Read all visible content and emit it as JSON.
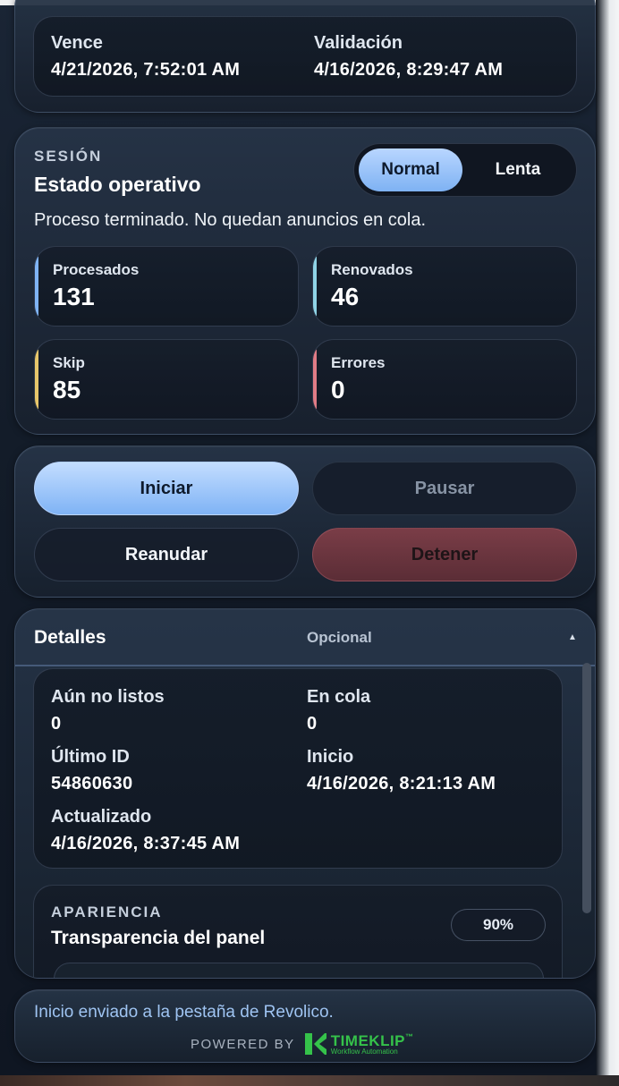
{
  "license": {
    "expires_label": "Vence",
    "expires_value": "4/21/2026, 7:52:01 AM",
    "validation_label": "Validación",
    "validation_value": "4/16/2026, 8:29:47 AM"
  },
  "session": {
    "eyebrow": "SESIÓN",
    "title": "Estado operativo",
    "mode_normal": "Normal",
    "mode_slow": "Lenta",
    "status_text": "Proceso terminado. No quedan anuncios en cola.",
    "stats": [
      {
        "label": "Procesados",
        "value": "131",
        "accent": "#7fb3f5"
      },
      {
        "label": "Renovados",
        "value": "46",
        "accent": "#8fd3e6"
      },
      {
        "label": "Skip",
        "value": "85",
        "accent": "#e7c66a"
      },
      {
        "label": "Errores",
        "value": "0",
        "accent": "#e07c86"
      }
    ]
  },
  "controls": {
    "start": "Iniciar",
    "pause": "Pausar",
    "resume": "Reanudar",
    "stop": "Detener"
  },
  "details": {
    "title": "Detalles",
    "optional": "Opcional",
    "toggle_glyph": "▲",
    "not_ready_label": "Aún no listos",
    "not_ready_value": "0",
    "queue_label": "En cola",
    "queue_value": "0",
    "last_id_label": "Último ID",
    "last_id_value": "54860630",
    "start_label": "Inicio",
    "start_value": "4/16/2026, 8:21:13 AM",
    "updated_label": "Actualizado",
    "updated_value": "4/16/2026, 8:37:45 AM"
  },
  "appearance": {
    "eyebrow": "APARIENCIA",
    "title": "Transparencia del panel",
    "opacity": "90%"
  },
  "footer": {
    "message": "Inicio enviado a la pestaña de Revolico.",
    "powered_by": "POWERED BY",
    "brand": "TIMEKLIP",
    "brand_tm": "™",
    "brand_tagline": "Workflow Automation",
    "brand_color": "#35c24a"
  }
}
